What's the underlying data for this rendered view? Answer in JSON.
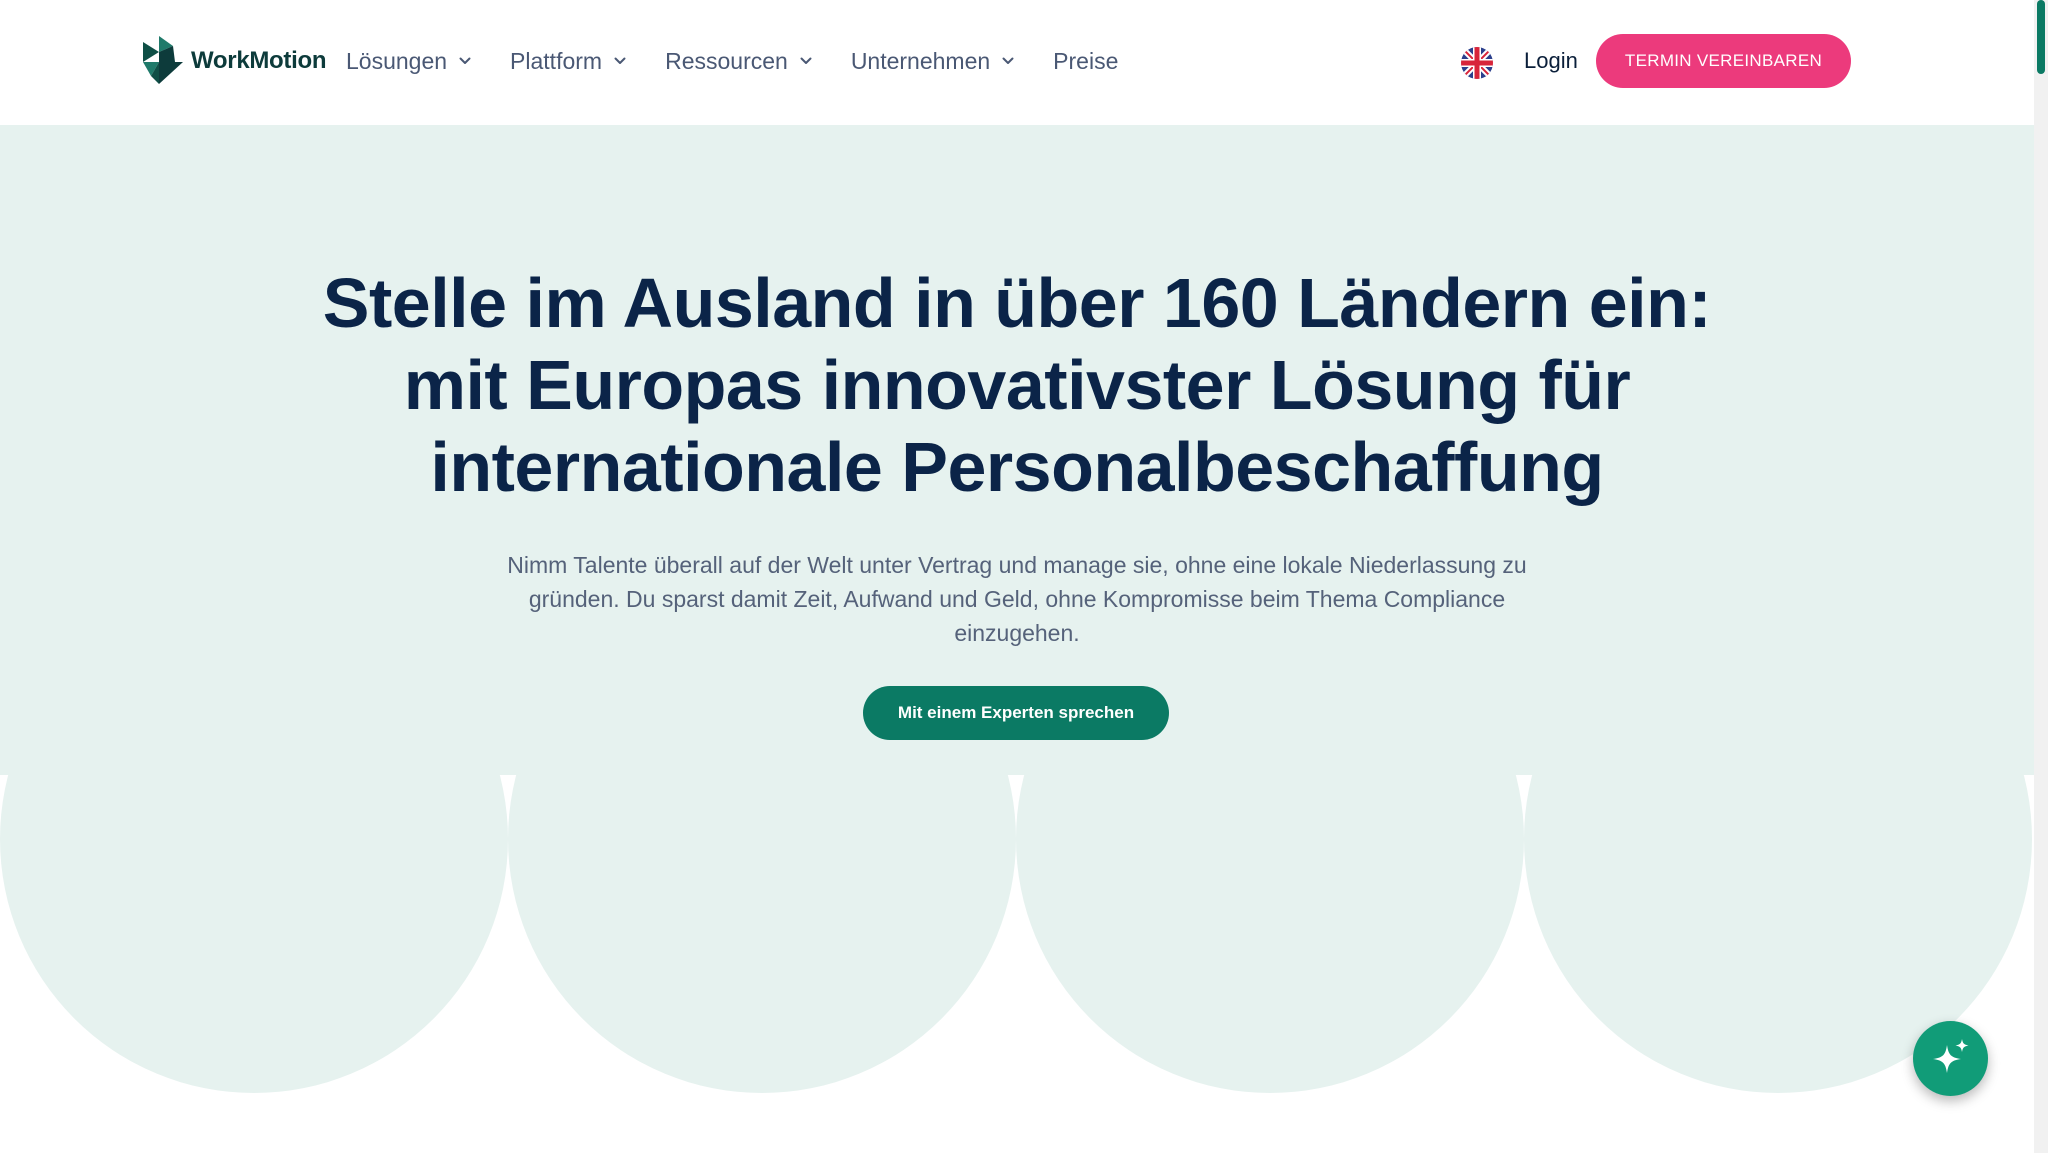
{
  "header": {
    "logo_text": "WorkMotion",
    "nav": [
      {
        "label": "Lösungen",
        "has_dropdown": true
      },
      {
        "label": "Plattform",
        "has_dropdown": true
      },
      {
        "label": "Ressourcen",
        "has_dropdown": true
      },
      {
        "label": "Unternehmen",
        "has_dropdown": true
      },
      {
        "label": "Preise",
        "has_dropdown": false
      }
    ],
    "language_icon": "uk-flag-icon",
    "login_label": "Login",
    "cta_label": "TERMIN VEREINBAREN"
  },
  "hero": {
    "title_lines": [
      "Stelle im Ausland in über 160 Ländern ein:",
      "mit Europas innovativster Lösung für",
      "internationale Personalbeschaffung"
    ],
    "subtitle": "Nimm Talente überall auf der Welt unter Vertrag und manage sie, ohne eine lokale Niederlassung zu gründen. Du sparst damit Zeit, Aufwand und Geld, ohne Kompromisse beim Thema Compliance einzugehen.",
    "cta_label": "Mit einem Experten sprechen"
  },
  "fab": {
    "icon": "sparkle-icon"
  },
  "colors": {
    "brand_dark": "#0b2448",
    "brand_green": "#0b7a64",
    "accent_pink": "#ec3a7c",
    "hero_bg": "#e6f2ef",
    "fab_green": "#119c78"
  }
}
